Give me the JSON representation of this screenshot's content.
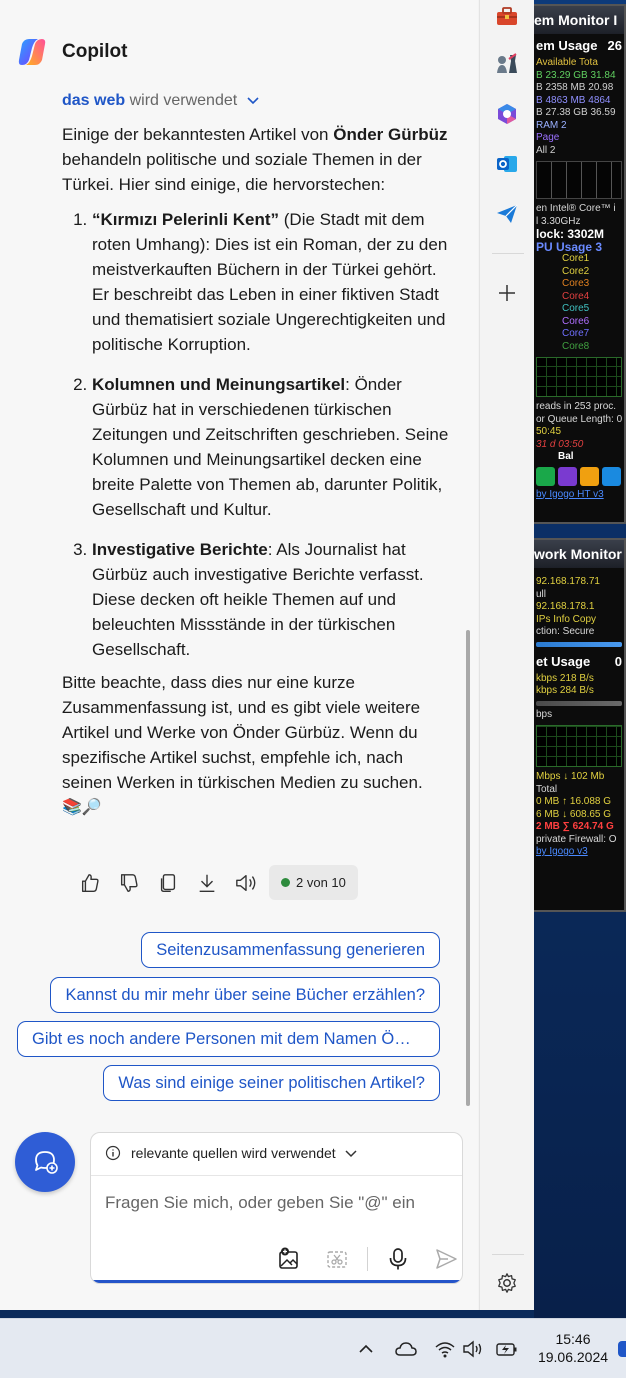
{
  "app": {
    "title": "Copilot"
  },
  "source": {
    "link": "das web",
    "text": "wird verwendet"
  },
  "answer": {
    "intro_prefix": "Einige der bekanntesten Artikel von ",
    "intro_name": "Önder Gürbüz",
    "intro_suffix": " behandeln politische und soziale Themen in der Türkei. Hier sind einige, die hervorstechen:",
    "items": [
      {
        "title": "“Kırmızı Pelerinli Kent”",
        "text": " (Die Stadt mit dem roten Umhang): Dies ist ein Roman, der zu den meistverkauften Büchern in der Türkei gehört. Er beschreibt das Leben in einer fiktiven Stadt und thematisiert soziale Ungerechtigkeiten und politische Korruption."
      },
      {
        "title": "Kolumnen und Meinungsartikel",
        "text": ": Önder Gürbüz hat in verschiedenen türkischen Zeitungen und Zeitschriften geschrieben. Seine Kolumnen und Meinungsartikel decken eine breite Palette von Themen ab, darunter Politik, Gesellschaft und Kultur."
      },
      {
        "title": "Investigative Berichte",
        "text": ": Als Journalist hat Gürbüz auch investigative Berichte verfasst. Diese decken oft heikle Themen auf und beleuchten Missstände in der türkischen Gesellschaft."
      }
    ],
    "outro": "Bitte beachte, dass dies nur eine kurze Zusammenfassung ist, und es gibt viele weitere Artikel und Werke von Önder Gürbüz. Wenn du spezifische Artikel suchst, empfehle ich, nach seinen Werken in türkischen Medien zu suchen.",
    "emoji": "📚🔎"
  },
  "actions": {
    "page_indicator": "2 von 10"
  },
  "suggestions": [
    "Seitenzusammenfassung generieren",
    "Kannst du mir mehr über seine Bücher erzählen?",
    "Gibt es noch andere Personen mit dem Namen Ö…",
    "Was sind einige seiner politischen Artikel?"
  ],
  "composer": {
    "chip": "relevante quellen wird verwendet",
    "placeholder": "Fragen Sie mich, oder geben Sie \"@\" ein"
  },
  "taskbar": {
    "time": "15:46",
    "date": "19.06.2024"
  },
  "widgets": {
    "system": {
      "title": "em Monitor I",
      "usage_label": "em Usage",
      "usage_value": "26",
      "rows": [
        "  Available   Tota",
        "B  23.29 GB  31.84",
        "B  2358 MB  20.98",
        "B  4863 MB  4864",
        "B  27.38 GB  36.59",
        "          RAM  2",
        "          Page",
        "          All   2"
      ],
      "cpu_rows": [
        "en Intel® Core™ i",
        "l 3.30GHz",
        "lock:    3302M",
        "PU Usage     3"
      ],
      "cores": [
        "Core1",
        "Core2",
        "Core3",
        "Core4",
        "Core5",
        "Core6",
        "Core7",
        "Core8"
      ],
      "threads": "reads in 253 proc.",
      "queue": "or Queue Length: 0",
      "uptime": "50:45",
      "uptime2": "31 d 03:50",
      "bal": "Bal",
      "footer": "by Igogo  HT v3"
    },
    "network": {
      "title": "work Monitor",
      "rows": [
        "92.168.178.71",
        "ull",
        "92.168.178.1",
        "IPs   Info   Copy",
        "ction: Secure"
      ],
      "usage_label": "et Usage",
      "usage_value": "0",
      "speeds": [
        "kbps    218 B/s",
        "kbps    284 B/s"
      ],
      "graph_label": "bps",
      "totals": [
        "Mbps ↓ 102 Mb",
        "        Total",
        "0 MB  ↑ 16.088 G",
        "6 MB  ↓ 608.65 G",
        "2 MB  ∑ 624.74 G",
        "private  Firewall: O"
      ],
      "footer": "by Igogo  v3"
    }
  }
}
